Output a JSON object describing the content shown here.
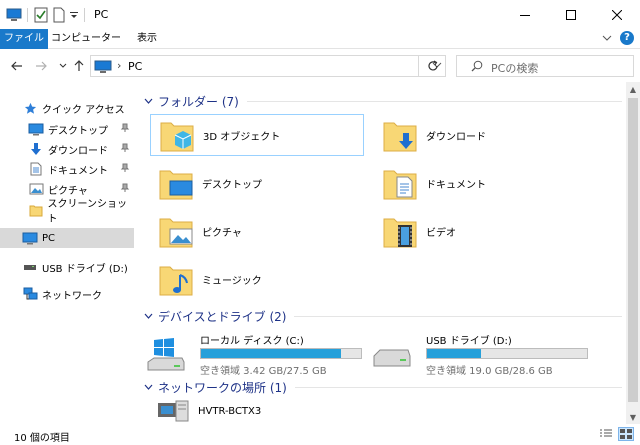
{
  "window": {
    "title": "PC"
  },
  "ribbon": {
    "tabs": [
      {
        "label": "ファイル"
      },
      {
        "label": "コンピューター"
      },
      {
        "label": "表示"
      }
    ],
    "help": "?"
  },
  "address": {
    "path": "PC"
  },
  "search": {
    "placeholder": "PCの検索"
  },
  "nav": {
    "quick_access": "クイック アクセス",
    "quick_items": [
      {
        "label": "デスクトップ"
      },
      {
        "label": "ダウンロード"
      },
      {
        "label": "ドキュメント"
      },
      {
        "label": "ピクチャ"
      },
      {
        "label": "スクリーンショット"
      }
    ],
    "pc": "PC",
    "usb": "USB ドライブ (D:)",
    "network": "ネットワーク"
  },
  "groups": {
    "folders": {
      "header": "フォルダー (7)",
      "items": [
        {
          "name": "3D オブジェクト"
        },
        {
          "name": "ダウンロード"
        },
        {
          "name": "デスクトップ"
        },
        {
          "name": "ドキュメント"
        },
        {
          "name": "ピクチャ"
        },
        {
          "name": "ビデオ"
        },
        {
          "name": "ミュージック"
        }
      ]
    },
    "drives": {
      "header": "デバイスとドライブ (2)",
      "items": [
        {
          "name": "ローカル ディスク (C:)",
          "free": "空き領域 3.42 GB/27.5 GB",
          "used_fraction": 0.876
        },
        {
          "name": "USB ドライブ (D:)",
          "free": "空き領域 19.0 GB/28.6 GB",
          "used_fraction": 0.336
        }
      ]
    },
    "network": {
      "header": "ネットワークの場所 (1)",
      "items": [
        {
          "name": "HVTR-BCTX3"
        }
      ]
    }
  },
  "status": {
    "count": "10 個の項目"
  },
  "colors": {
    "accent": "#1979ca",
    "group_header": "#1e3287",
    "drive_bar": "#26a0da",
    "selection": "#d9d9d9"
  }
}
